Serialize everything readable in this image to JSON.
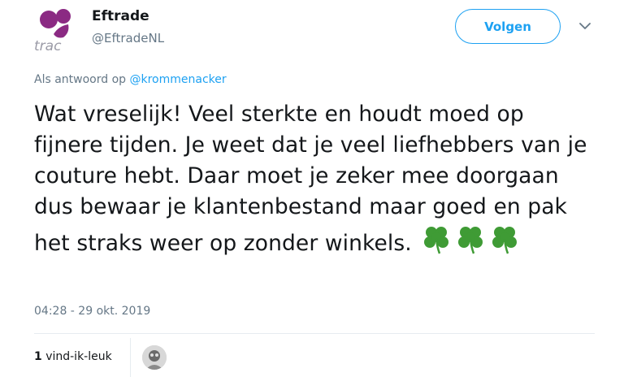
{
  "account": {
    "display_name": "Eftrade",
    "handle": "@EftradeNL",
    "avatar_letters": "trac"
  },
  "header": {
    "follow_label": "Volgen"
  },
  "reply": {
    "prefix": "Als antwoord op ",
    "mention": "@krommenacker"
  },
  "tweet": {
    "text": "Wat vreselijk! Veel sterkte en houdt moed op fijnere tijden. Je weet dat je veel liefhebbers van je couture hebt. Daar moet je zeker mee doorgaan dus bewaar je klantenbestand maar goed en pak het straks weer op zonder winkels.",
    "emoji": [
      "four-leaf-clover",
      "four-leaf-clover",
      "four-leaf-clover"
    ],
    "timestamp": "04:28 - 29 okt. 2019"
  },
  "engagement": {
    "likes_count": "1",
    "likes_label": " vind-ik-leuk"
  },
  "colors": {
    "accent": "#1da1f2",
    "brand_purple": "#8b2a83",
    "muted": "#657786",
    "clover": "#3f9b35"
  }
}
